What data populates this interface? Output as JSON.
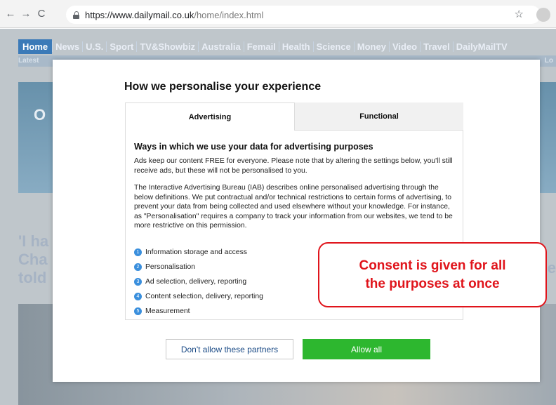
{
  "browser": {
    "url_host": "https://www.dailymail.co.uk",
    "url_path": "/home/index.html",
    "back_icon": "←",
    "forward_icon": "→",
    "reload_icon": "C",
    "star_icon": "☆"
  },
  "site": {
    "nav_home": "Home",
    "nav_items": [
      "News",
      "U.S.",
      "Sport",
      "TV&Showbiz",
      "Australia",
      "Femail",
      "Health",
      "Science",
      "Money",
      "Video",
      "Travel",
      "DailyMailTV"
    ],
    "latest": "Latest",
    "lo": "Lo",
    "hero_letter": "O",
    "headline_lines": [
      "'I ha",
      "Cha",
      "told"
    ],
    "headline_right": "e"
  },
  "modal": {
    "title": "How we personalise your experience",
    "tabs": [
      {
        "label": "Advertising",
        "active": true
      },
      {
        "label": "Functional",
        "active": false
      }
    ],
    "panel_heading": "Ways in which we use your data for advertising purposes",
    "para1": "Ads keep our content FREE for everyone. Please note that by altering the settings below, you'll still receive ads, but these will not be personalised to you.",
    "para2": "The Interactive Advertising Bureau (IAB) describes online personalised advertising through the below definitions. We put contractual and/or technical restrictions to certain forms of advertising, to prevent your data from being collected and used elsewhere without your knowledge. For instance, as \"Personalisation\" requires a company to track your information from our websites, we tend to be more restrictive on this permission.",
    "purposes": [
      {
        "num": "1",
        "label": "Information storage and access"
      },
      {
        "num": "2",
        "label": "Personalisation"
      },
      {
        "num": "3",
        "label": "Ad selection, delivery, reporting"
      },
      {
        "num": "4",
        "label": "Content selection, delivery, reporting"
      },
      {
        "num": "5",
        "label": "Measurement"
      }
    ],
    "deny_label": "Don't allow these partners",
    "allow_label": "Allow all"
  },
  "annotation": {
    "text": "Consent is  given for all\nthe purposes at once",
    "color": "#e0141b"
  },
  "colors": {
    "allow_button": "#2db72f",
    "link_blue": "#1b4b86",
    "purpose_badge": "#3a8fdd"
  }
}
